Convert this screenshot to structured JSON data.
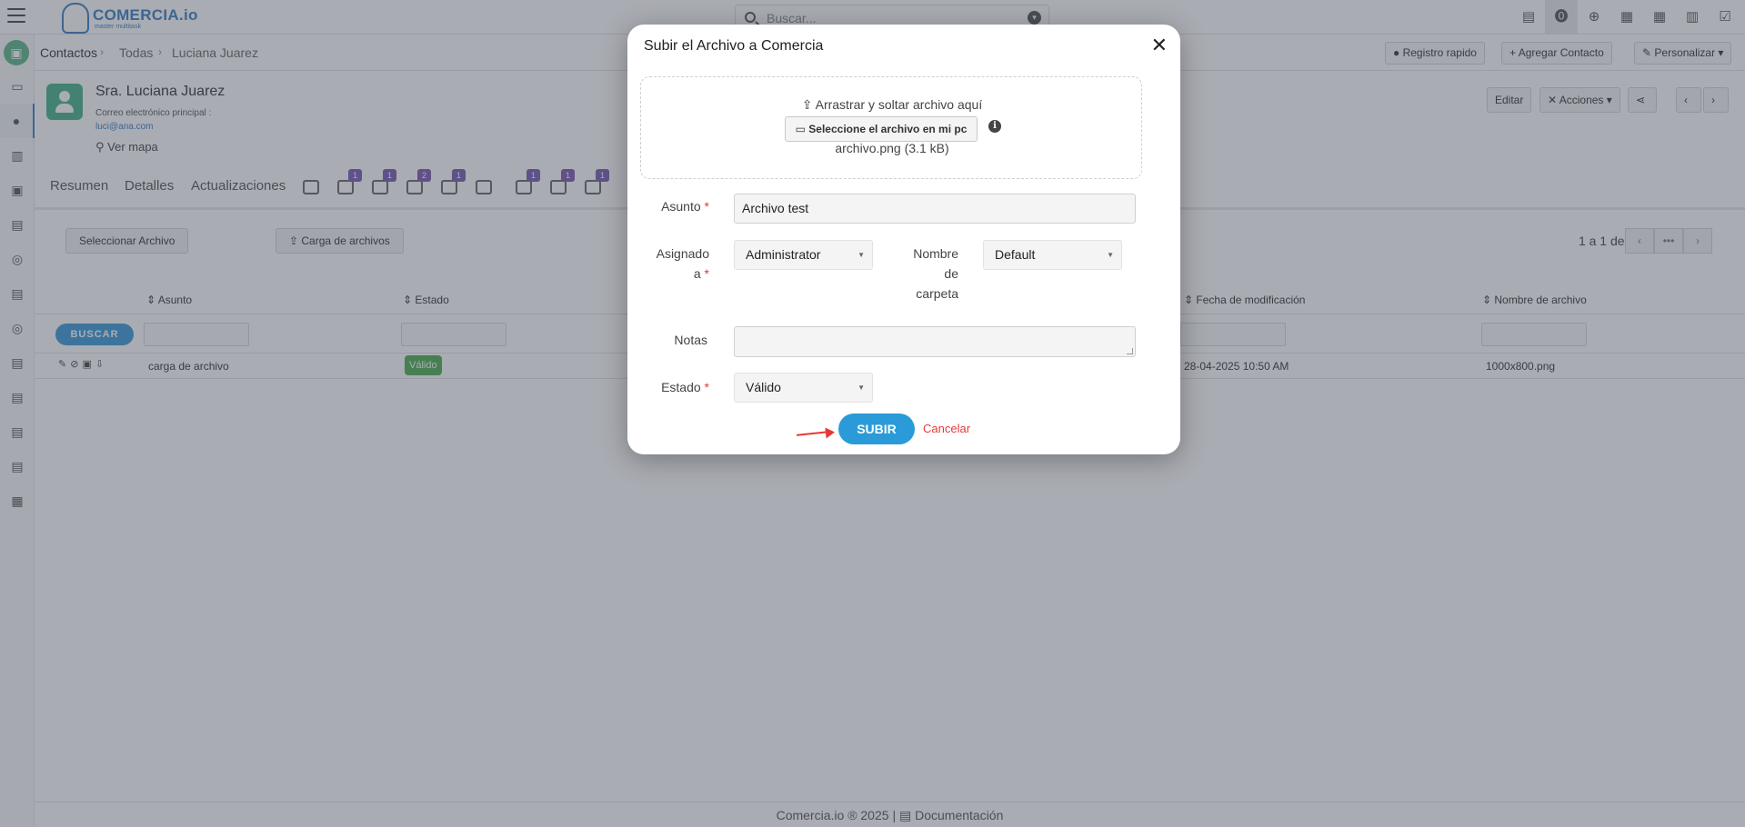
{
  "app": {
    "logo_text": "COMERCIA.io",
    "logo_sub": "master multitask"
  },
  "search": {
    "placeholder": "Buscar..."
  },
  "breadcrumb": {
    "items": [
      "Contactos",
      "Todas",
      "Luciana Juarez"
    ]
  },
  "header_actions": {
    "quick_register": "Registro rapido",
    "add_contact": "Agregar Contacto",
    "customize": "Personalizar"
  },
  "contact": {
    "name": "Sra. Luciana Juarez",
    "email_label": "Correo electrónico principal :",
    "email": "luci@ana.com",
    "map_link": "Ver mapa",
    "edit": "Editar",
    "actions": "Acciones"
  },
  "tabs": {
    "summary": "Resumen",
    "details": "Detalles",
    "updates": "Actualizaciones",
    "badges": [
      "1",
      "1",
      "2",
      "1",
      "1",
      "1",
      "1"
    ]
  },
  "panel": {
    "select_file": "Seleccionar Archivo",
    "upload_files": "Carga de archivos",
    "pager": "1 a 1  de",
    "pager_help": "?",
    "columns": {
      "subject": "Asunto",
      "status": "Estado",
      "modified": "Fecha de modificación",
      "filename": "Nombre de archivo"
    },
    "search_button": "BUSCAR",
    "row": {
      "subject": "carga de archivo",
      "status": "Válido",
      "modified": "28-04-2025 10:50 AM",
      "filename": "1000x800.png"
    }
  },
  "footer": {
    "brand": "Comercia.io ® 2025",
    "sep": "|",
    "docs": "Documentación"
  },
  "modal": {
    "title": "Subir el Archivo a Comercia",
    "dropzone_text": "Arrastrar y soltar archivo aquí",
    "choose_button": "Seleccione el archivo en mi pc",
    "file_info": "archivo.png (3.1 kB)",
    "subject_label": "Asunto",
    "subject_value": "Archivo test",
    "assigned_label_1": "Asignado",
    "assigned_label_2": "a",
    "assigned_value": "Administrator",
    "folder_label_1": "Nombre",
    "folder_label_2": "de",
    "folder_label_3": "carpeta",
    "folder_value": "Default",
    "notes_label": "Notas",
    "status_label": "Estado",
    "status_value": "Válido",
    "required_mark": "*",
    "submit": "SUBIR",
    "cancel": "Cancelar"
  }
}
